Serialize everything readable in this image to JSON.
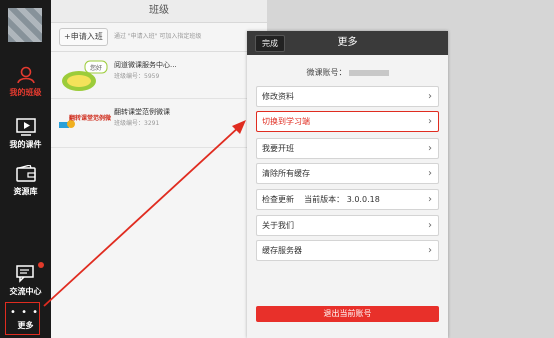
{
  "sidebar": {
    "items": [
      {
        "label": "我的班级",
        "icon": "person-icon",
        "active": true
      },
      {
        "label": "我的课件",
        "icon": "video-play-icon",
        "active": false
      },
      {
        "label": "资源库",
        "icon": "wallet-icon",
        "active": false
      },
      {
        "label": "交流中心",
        "icon": "chat-icon",
        "active": false
      },
      {
        "label": "更多",
        "icon": "more-dots-icon",
        "active": false
      }
    ],
    "more_dots": "• • •"
  },
  "class_panel": {
    "title": "班级",
    "apply_button": "+申请入班",
    "apply_hint": "通过 \"申请入班\" 可加入指定班级",
    "classes": [
      {
        "name": "阅道微课服务中心...",
        "code": "班级编号：5959",
        "thumb_text": "您好"
      },
      {
        "name": "翻转课堂范例微课",
        "code": "班级编号：3291",
        "thumb_text": "翻转课堂范例微课"
      }
    ]
  },
  "dialog": {
    "done_button": "完成",
    "title": "更多",
    "account_label": "微课账号：",
    "rows": [
      {
        "label": "修改资料",
        "highlighted": false
      },
      {
        "label": "切换到学习端",
        "highlighted": true
      },
      {
        "label": "我要开班",
        "highlighted": false
      },
      {
        "label": "清除所有缓存",
        "highlighted": false
      },
      {
        "label": "检查更新    当前版本： 3.0.0.18",
        "highlighted": false
      },
      {
        "label": "关于我们",
        "highlighted": false
      },
      {
        "label": "缓存服务器",
        "highlighted": false
      }
    ],
    "chevron": "›",
    "logout_button": "退出当前账号"
  },
  "colors": {
    "accent_red": "#e02c20",
    "sidebar_bg": "#1a1a1a",
    "dialog_header": "#3a3a3a"
  }
}
